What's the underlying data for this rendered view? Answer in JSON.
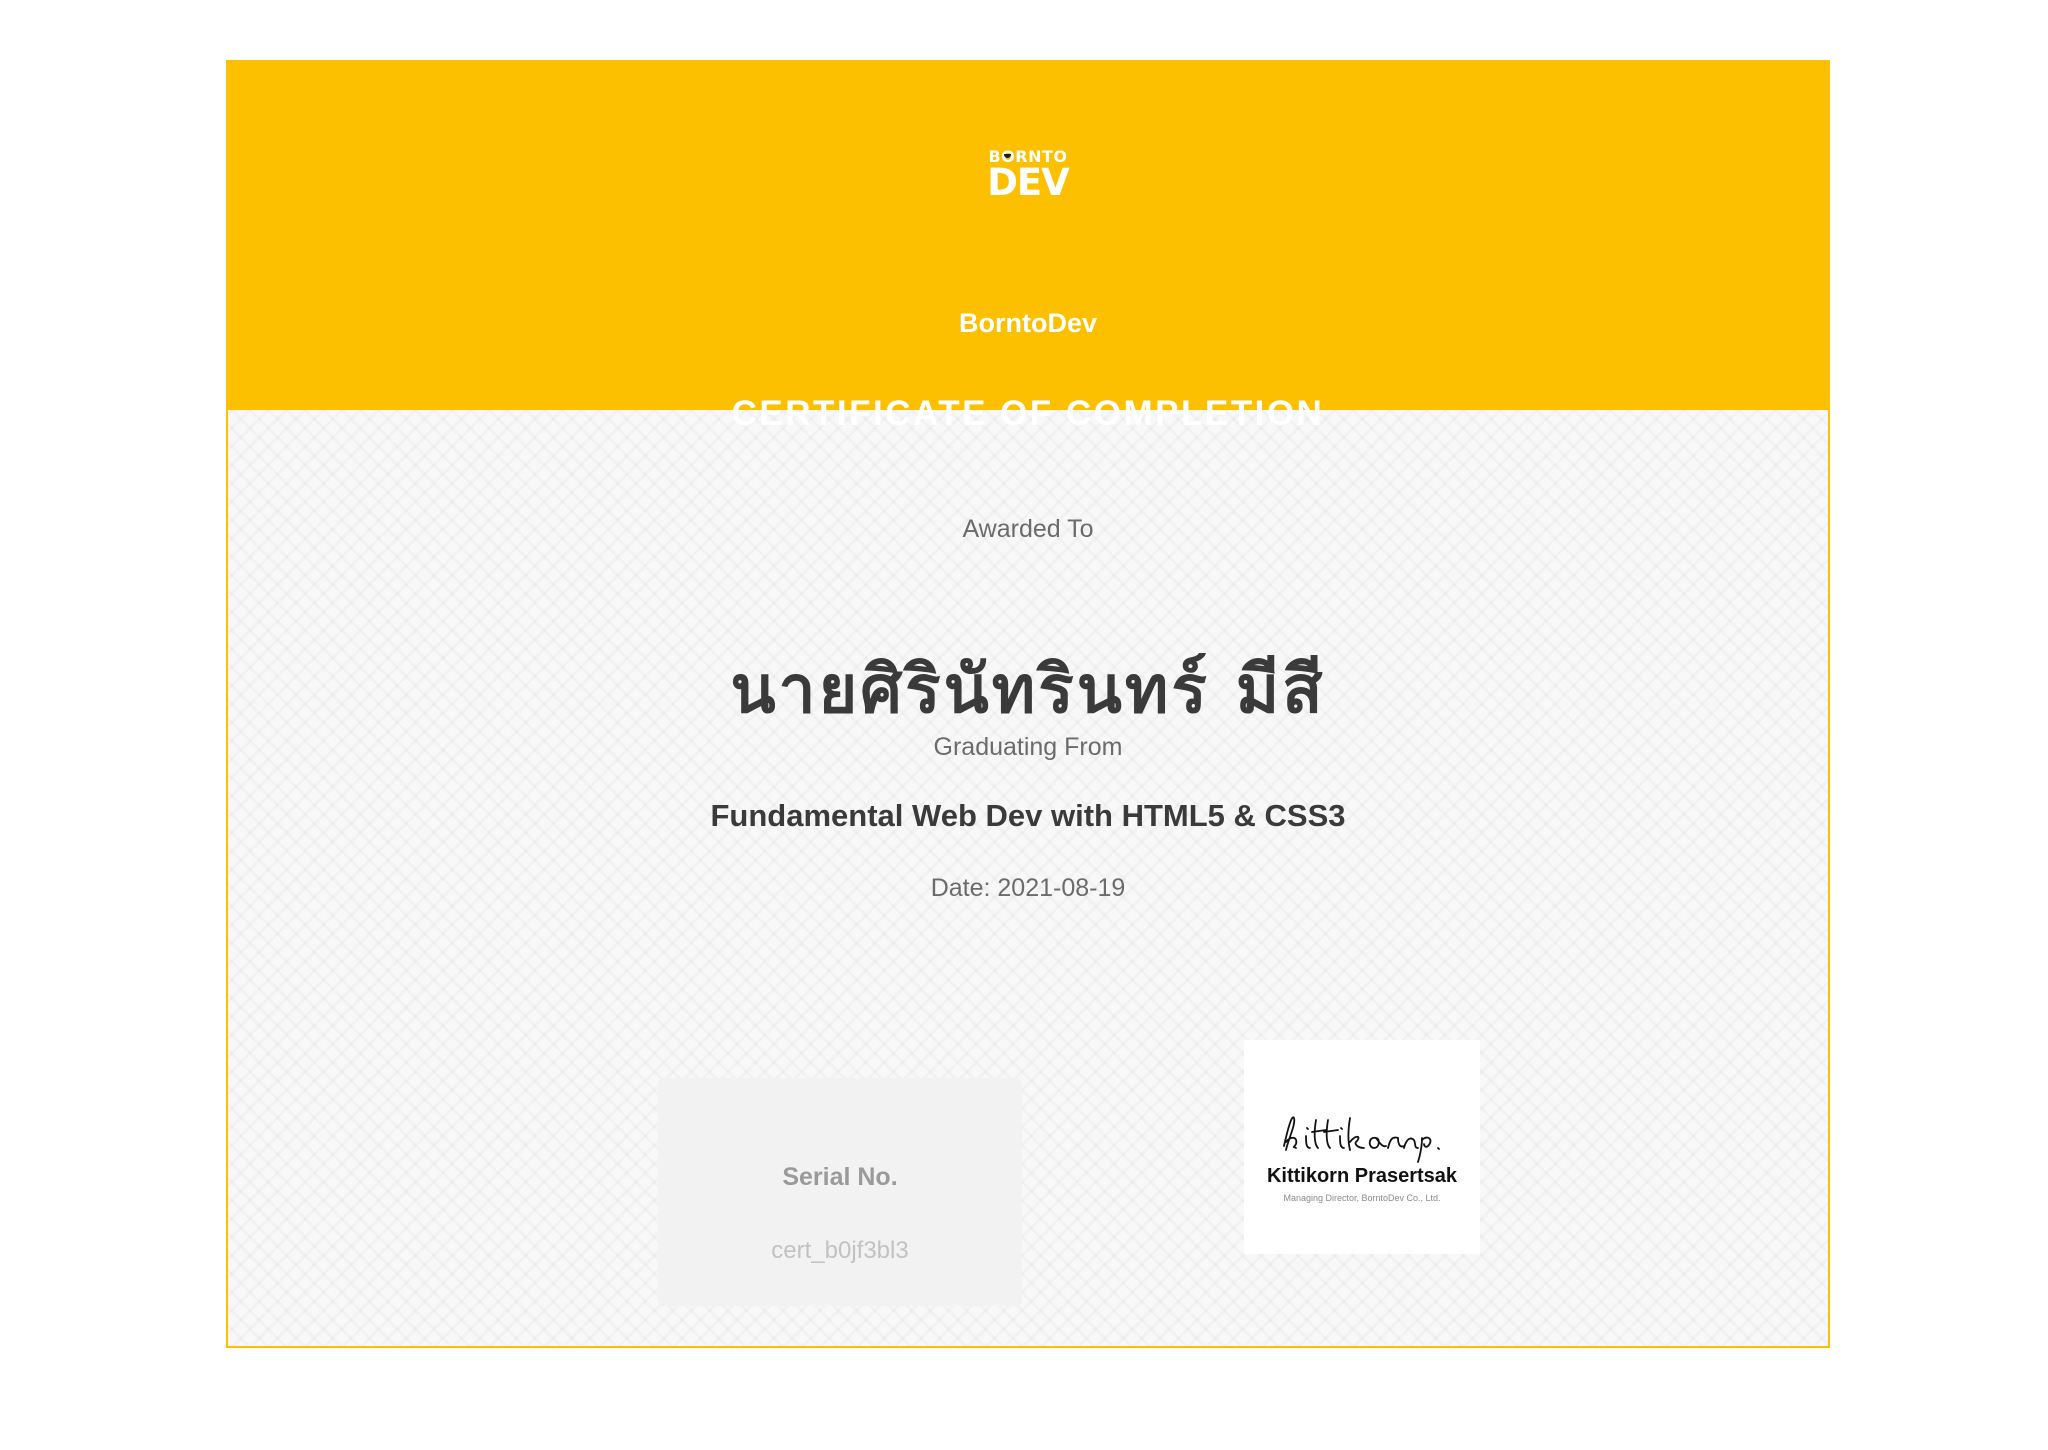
{
  "certificate": {
    "logo": {
      "top_text": "BORNTO",
      "bottom_text": "DEV"
    },
    "org_name": "BorntoDev",
    "title": "CERTIFICATE OF COMPLETION",
    "awarded_label": "Awarded To",
    "recipient_name": "นายศิรินัทรินทร์ มีสี",
    "graduating_label": "Graduating From",
    "course_name": "Fundamental Web Dev with HTML5 & CSS3",
    "date_text": "Date: 2021-08-19",
    "serial": {
      "label": "Serial No.",
      "value": "cert_b0jf3bl3"
    },
    "signature": {
      "script_text": "kittikorn p.",
      "signer_name": "Kittikorn Prasertsak",
      "signer_role": "Managing Director, BorntoDev Co., Ltd."
    }
  },
  "colors": {
    "accent": "#fdc000",
    "text_dark": "#3a3a3a",
    "text_muted": "#6b6b6b"
  }
}
